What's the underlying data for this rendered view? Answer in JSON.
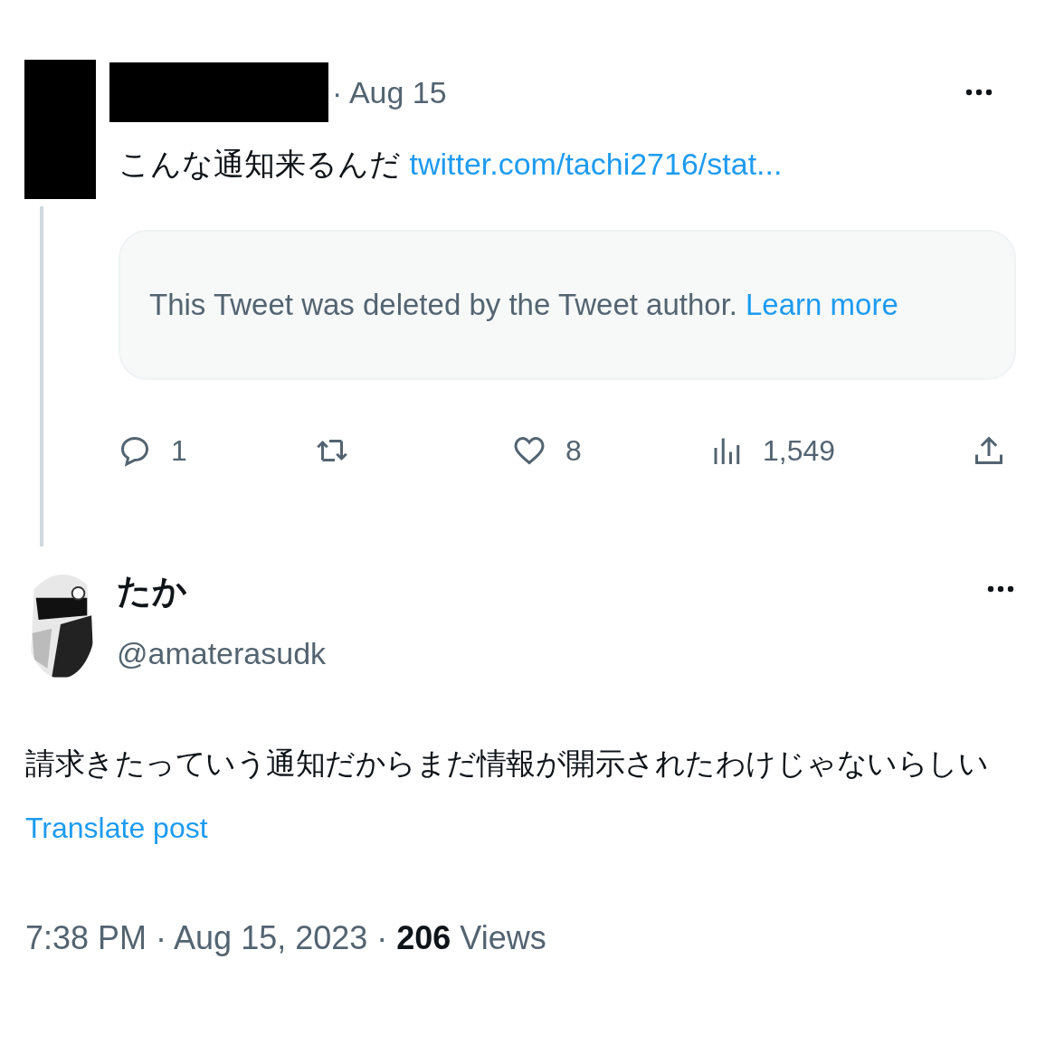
{
  "reply_tweet": {
    "date": "· Aug 15",
    "text": "こんな通知来るんだ",
    "link": "twitter.com/tachi2716/stat...",
    "quoted": {
      "text": "This Tweet was deleted by the Tweet author.",
      "link": "Learn more"
    },
    "actions": [
      {
        "kind": "reply",
        "count": "1"
      },
      {
        "kind": "retweet"
      },
      {
        "kind": "like",
        "count": "8"
      },
      {
        "kind": "views",
        "count": "1,549"
      },
      {
        "kind": "share"
      }
    ]
  },
  "main_tweet": {
    "name": "たか",
    "handle": "@amaterasudk",
    "text": "請求きたっていう通知だからまだ情報が開示されたわけじゃないらしい",
    "translate": "Translate post",
    "meta": "7:38 PM · Aug 15, 2023 · **206** Views"
  }
}
